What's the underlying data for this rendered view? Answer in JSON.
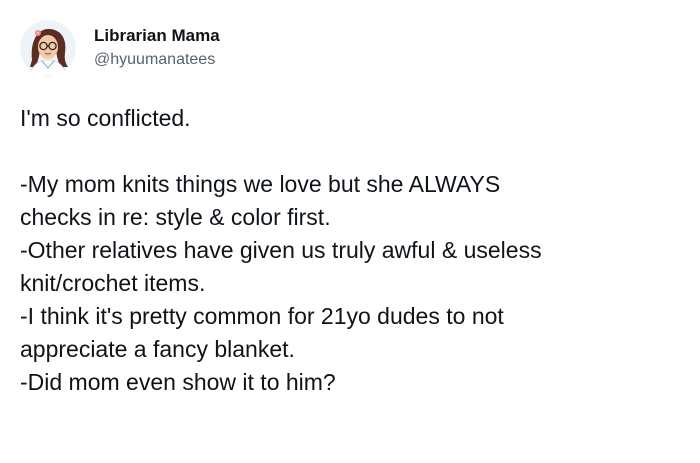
{
  "author": {
    "display_name": "Librarian Mama",
    "handle": "@hyuumanatees",
    "avatar_icon": "profile-avatar-illustration-icon"
  },
  "tweet": {
    "intro": "I'm so conflicted.",
    "lines": [
      "-My mom knits things we love but she ALWAYS",
      "checks in re: style & color first.",
      "-Other relatives have given us truly awful & useless",
      "knit/crochet items.",
      "-I think it's pretty common for 21yo dudes to not",
      "appreciate a fancy blanket.",
      "-Did mom even show it to him?"
    ]
  },
  "colors": {
    "text": "#0f1419",
    "secondary": "#536471",
    "background": "#ffffff"
  }
}
